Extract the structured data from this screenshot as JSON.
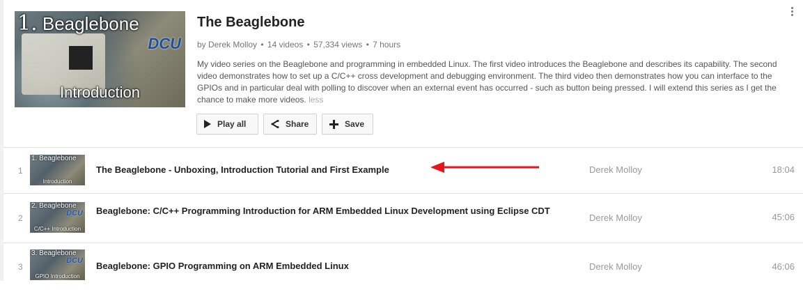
{
  "playlist": {
    "title": "The Beaglebone",
    "owner": "by Derek Molloy",
    "video_count": "14 videos",
    "views": "57,334 views",
    "updated": "7 hours",
    "separator": "•",
    "description": "My video series on the Beaglebone and programming in embedded Linux. The first video introduces the Beaglebone and describes its capability. The second video demonstrates how to set up a C/C++ cross development and debugging environment. The third video then demonstrates how you can interface to the GPIOs and in particular deal with polling to discover when an external event has occurred - such as button being pressed. I will extend this series as I get the chance to make more videos.",
    "less_label": "less",
    "thumbnail": {
      "number": "1.",
      "top_text": "Beaglebone",
      "bottom_text": "Introduction",
      "logo_text": "DCU"
    }
  },
  "actions": {
    "play_all": "Play all",
    "share": "Share",
    "save": "Save"
  },
  "videos": [
    {
      "index": "1",
      "title": "The Beaglebone - Unboxing, Introduction Tutorial and First Example",
      "owner": "Derek Molloy",
      "duration": "18:04",
      "thumb_top": "1. Beaglebone",
      "thumb_bottom": "Introduction",
      "thumb_logo": ""
    },
    {
      "index": "2",
      "title": "Beaglebone: C/C++ Programming Introduction for ARM Embedded Linux Development using Eclipse CDT",
      "owner": "Derek Molloy",
      "duration": "45:06",
      "thumb_top": "2. Beaglebone",
      "thumb_bottom": "C/C++ Introduction",
      "thumb_logo": "DCU"
    },
    {
      "index": "3",
      "title": "Beaglebone: GPIO Programming on ARM Embedded Linux",
      "owner": "Derek Molloy",
      "duration": "46:06",
      "thumb_top": "3. Beaglebone",
      "thumb_bottom": "GPIO Introduction",
      "thumb_logo": "DCU"
    }
  ],
  "annotation": {
    "arrow_color": "#e8141b"
  },
  "colors": {
    "meta_gray": "#767676",
    "border": "#e2e2e2"
  }
}
